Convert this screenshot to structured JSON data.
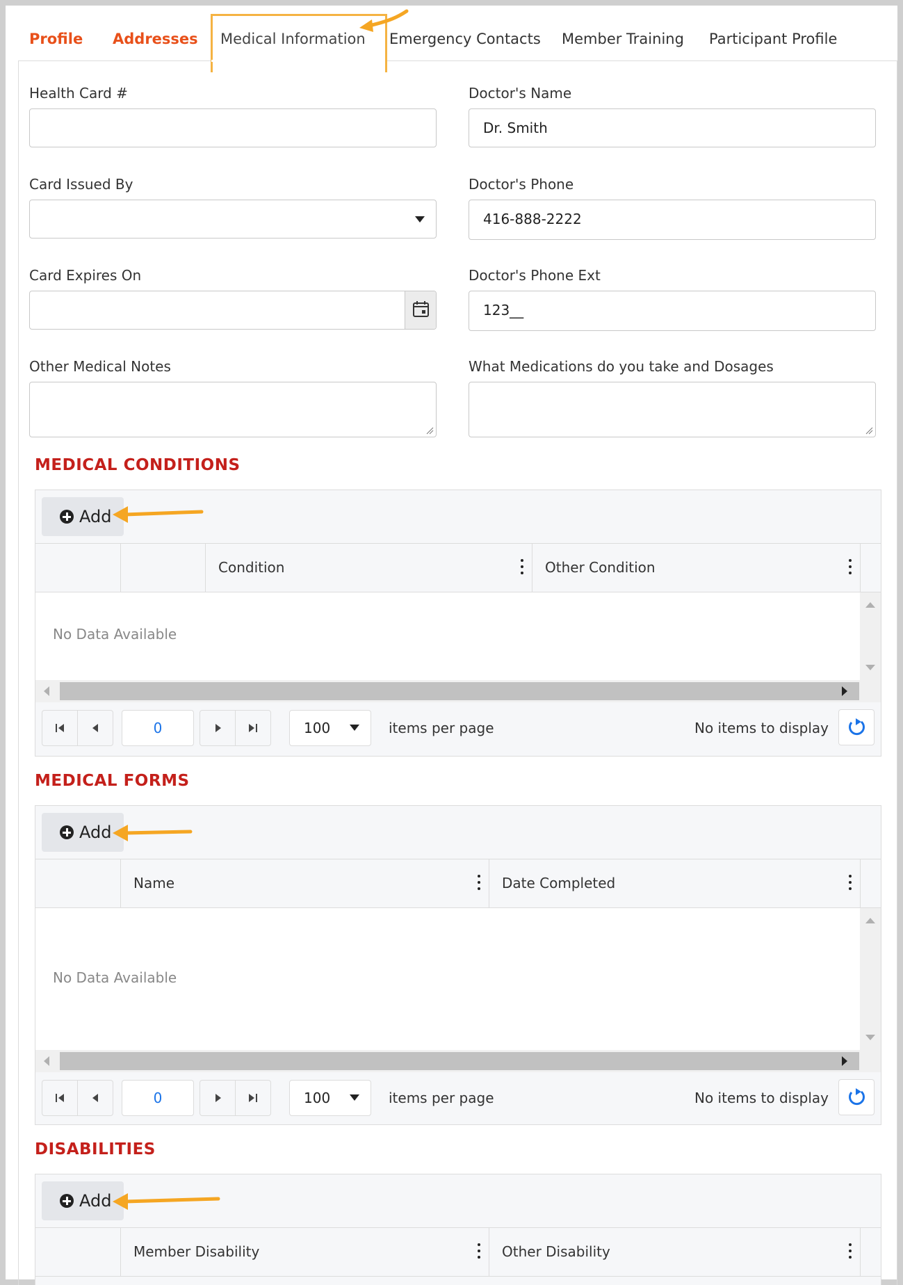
{
  "tabs": [
    {
      "label": "Profile"
    },
    {
      "label": "Addresses"
    },
    {
      "label": "Medical Information"
    },
    {
      "label": "Emergency Contacts"
    },
    {
      "label": "Member Training"
    },
    {
      "label": "Participant Profile"
    }
  ],
  "form": {
    "health_card_label": "Health Card #",
    "health_card_value": "",
    "doctor_name_label": "Doctor's Name",
    "doctor_name_value": "Dr. Smith",
    "card_issued_label": "Card Issued By",
    "card_issued_value": "",
    "doctor_phone_label": "Doctor's Phone",
    "doctor_phone_value": "416-888-2222",
    "card_expires_label": "Card Expires On",
    "card_expires_value": "",
    "doctor_ext_label": "Doctor's Phone Ext",
    "doctor_ext_value": "123__",
    "other_notes_label": "Other Medical Notes",
    "medications_label": "What Medications do you take and Dosages"
  },
  "sections": {
    "conditions": {
      "title": "MEDICAL CONDITIONS",
      "add_label": "Add",
      "columns": [
        "Condition",
        "Other Condition"
      ],
      "no_data": "No Data Available",
      "page": "0",
      "page_size": "100",
      "per_page_label": "items per page",
      "status": "No items to display"
    },
    "forms": {
      "title": "MEDICAL FORMS",
      "add_label": "Add",
      "columns": [
        "Name",
        "Date Completed"
      ],
      "no_data": "No Data Available",
      "page": "0",
      "page_size": "100",
      "per_page_label": "items per page",
      "status": "No items to display"
    },
    "disabilities": {
      "title": "DISABILITIES",
      "add_label": "Add",
      "columns": [
        "Member Disability",
        "Other Disability"
      ]
    }
  },
  "colors": {
    "accent_orange": "#e8501a",
    "section_red": "#c4201b",
    "annotation": "#f5a623",
    "link_blue": "#1a73e8"
  },
  "icons": [
    "calendar-icon",
    "plus-circle-icon",
    "kebab-menu-icon",
    "first-page-icon",
    "prev-page-icon",
    "next-page-icon",
    "last-page-icon",
    "refresh-icon",
    "dropdown-caret-icon",
    "annotation-arrow"
  ]
}
